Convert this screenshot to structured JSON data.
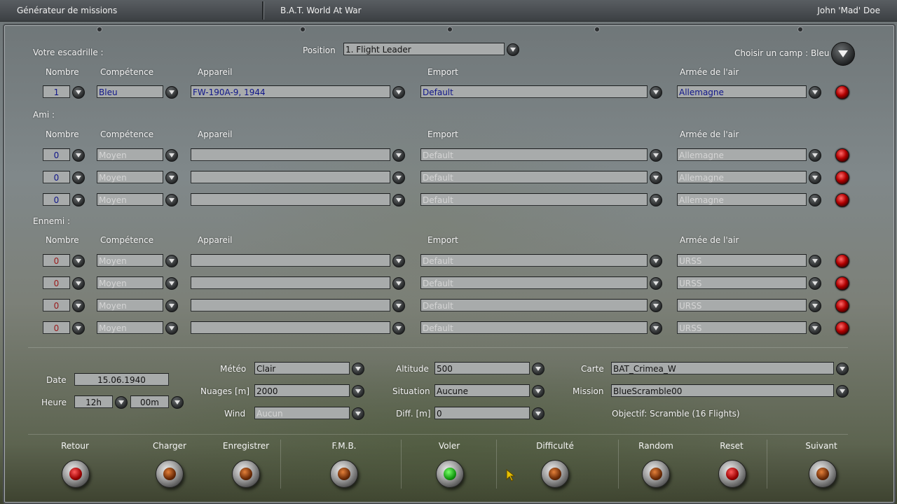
{
  "titlebar": {
    "left": "Générateur de missions",
    "center": "B.A.T. World At War",
    "right": "John 'Mad' Doe"
  },
  "squadron": {
    "label": "Votre escadrille :",
    "position_label": "Position",
    "position_value": "1. Flight Leader",
    "camp_label": "Choisir un camp : Bleu",
    "headers": {
      "nombre": "Nombre",
      "competence": "Compétence",
      "appareil": "Appareil",
      "emport": "Emport",
      "armee": "Armée de l'air"
    },
    "row": {
      "nombre": "1",
      "competence": "Bleu",
      "appareil": "FW-190A-9, 1944",
      "emport": "Default",
      "armee": "Allemagne"
    }
  },
  "friends": {
    "label": "Ami :",
    "headers": {
      "nombre": "Nombre",
      "competence": "Compétence",
      "appareil": "Appareil",
      "emport": "Emport",
      "armee": "Armée de l'air"
    },
    "rows": [
      {
        "nombre": "0",
        "competence": "Moyen",
        "appareil": "",
        "emport": "Default",
        "armee": "Allemagne"
      },
      {
        "nombre": "0",
        "competence": "Moyen",
        "appareil": "",
        "emport": "Default",
        "armee": "Allemagne"
      },
      {
        "nombre": "0",
        "competence": "Moyen",
        "appareil": "",
        "emport": "Default",
        "armee": "Allemagne"
      }
    ]
  },
  "enemies": {
    "label": "Ennemi :",
    "headers": {
      "nombre": "Nombre",
      "competence": "Compétence",
      "appareil": "Appareil",
      "emport": "Emport",
      "armee": "Armée de l'air"
    },
    "rows": [
      {
        "nombre": "0",
        "competence": "Moyen",
        "appareil": "",
        "emport": "Default",
        "armee": "URSS"
      },
      {
        "nombre": "0",
        "competence": "Moyen",
        "appareil": "",
        "emport": "Default",
        "armee": "URSS"
      },
      {
        "nombre": "0",
        "competence": "Moyen",
        "appareil": "",
        "emport": "Default",
        "armee": "URSS"
      },
      {
        "nombre": "0",
        "competence": "Moyen",
        "appareil": "",
        "emport": "Default",
        "armee": "URSS"
      }
    ]
  },
  "settings": {
    "date_label": "Date",
    "date_value": "15.06.1940",
    "heure_label": "Heure",
    "heure_h": "12h",
    "heure_m": "00m",
    "meteo_label": "Météo",
    "meteo_value": "Clair",
    "nuages_label": "Nuages [m]",
    "nuages_value": "2000",
    "wind_label": "Wind",
    "wind_value": "Aucun",
    "altitude_label": "Altitude",
    "altitude_value": "500",
    "situation_label": "Situation",
    "situation_value": "Aucune",
    "diff_label": "Diff. [m]",
    "diff_value": "0",
    "carte_label": "Carte",
    "carte_value": "BAT_Crimea_W",
    "mission_label": "Mission",
    "mission_value": "BlueScramble00",
    "objectif": "Objectif: Scramble (16 Flights)"
  },
  "buttons": {
    "retour": "Retour",
    "charger": "Charger",
    "enregistrer": "Enregistrer",
    "fmb": "F.M.B.",
    "voler": "Voler",
    "difficulte": "Difficulté",
    "random": "Random",
    "reset": "Reset",
    "suivant": "Suivant"
  }
}
